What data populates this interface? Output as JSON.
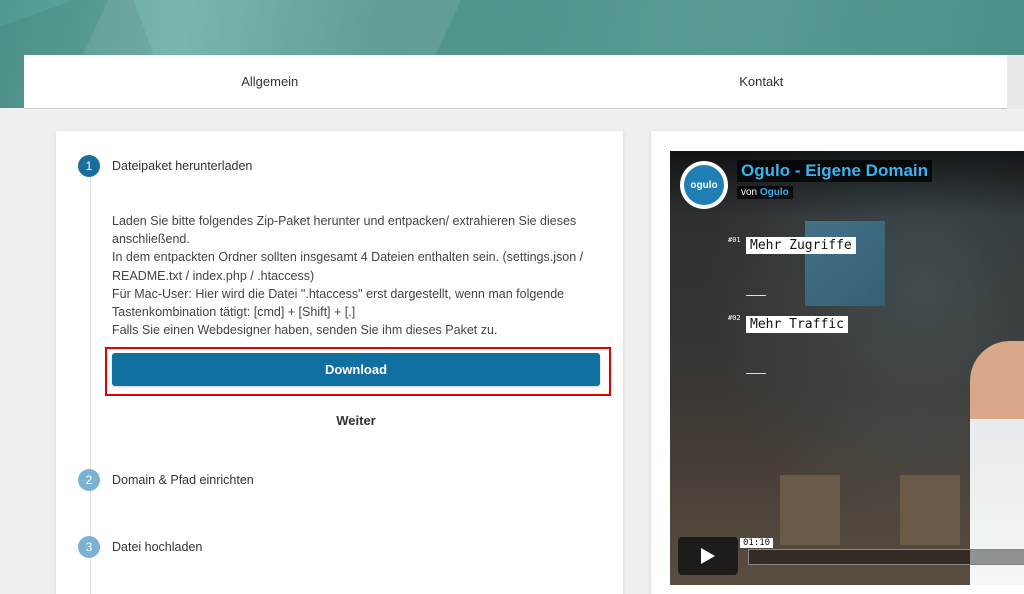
{
  "tabs": [
    {
      "label": "Allgemein"
    },
    {
      "label": "Kontakt"
    }
  ],
  "steps": [
    {
      "number": "1",
      "title": "Dateipaket herunterladen",
      "active": true
    },
    {
      "number": "2",
      "title": "Domain & Pfad einrichten",
      "active": false
    },
    {
      "number": "3",
      "title": "Datei hochladen",
      "active": false
    }
  ],
  "step1": {
    "description": [
      "Laden Sie bitte folgendes Zip-Paket herunter und entpacken/ extrahieren Sie dieses anschließend.",
      "In dem entpackten Ordner sollten insgesamt 4 Dateien enthalten sein. (settings.json / README.txt / index.php / .htaccess)",
      "Für Mac-User: Hier wird die Datei \".htaccess\" erst dargestellt, wenn man folgende Tastenkombination tätigt: [cmd] + [Shift] + [.]",
      "Falls Sie einen Webdesigner haben, senden Sie ihm dieses Paket zu."
    ],
    "download_label": "Download",
    "next_label": "Weiter"
  },
  "video": {
    "logo_text": "ogulo",
    "title": "Ogulo - Eigene Domain",
    "channel_prefix": "von",
    "channel_name": "Ogulo",
    "overlays": [
      {
        "num": "#01",
        "label": "Mehr Zugriffe"
      },
      {
        "num": "#02",
        "label": "Mehr Traffic"
      }
    ],
    "time": "01:10"
  },
  "colors": {
    "accent": "#10709f",
    "highlight": "#e10000",
    "header": "#5a9c95"
  }
}
